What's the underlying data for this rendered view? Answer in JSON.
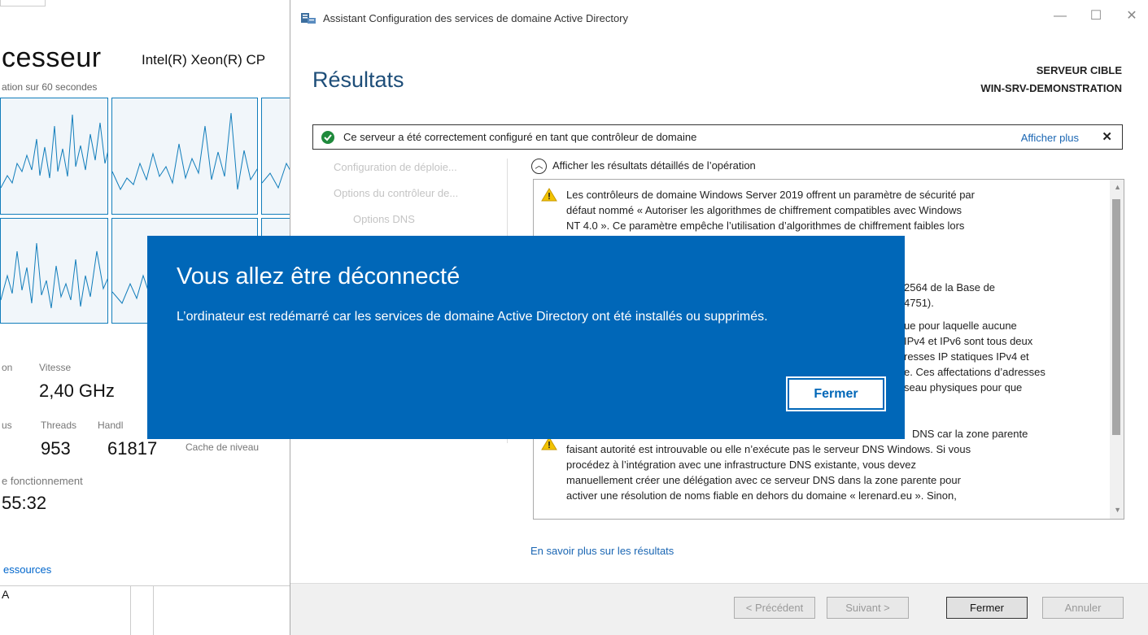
{
  "taskmanager": {
    "title": "cesseur",
    "cpu_name": "Intel(R) Xeon(R) CP",
    "subtitle": "ation sur 60 secondes",
    "stats": {
      "speed_label": "Vitesse",
      "speed_value": "2,40 GHz",
      "threads_label": "Threads",
      "threads_value": "953",
      "handles_label": "Handl",
      "handles_value": "61817",
      "cache_label": "Cache de niveau",
      "uptime_label": "e fonctionnement",
      "uptime_value": "55:32",
      "left_label_1": "on",
      "left_label_2": "us"
    },
    "resources_link": "essources",
    "bottom_letter": "A"
  },
  "wizard": {
    "title": "Assistant Configuration des services de domaine Active Directory",
    "heading": "Résultats",
    "target_label": "SERVEUR CIBLE",
    "target_name": "WIN-SRV-DEMONSTRATION",
    "success_text": "Ce serveur a été correctement configuré en tant que contrôleur de domaine",
    "show_more": "Afficher plus",
    "close_symbol": "✕",
    "nav": [
      "Configuration de déploie...",
      "Options du contrôleur de...",
      "Options DNS"
    ],
    "details_header": "Afficher les résultats détaillés de l’opération",
    "messages": [
      {
        "lines": [
          "Les contrôleurs de domaine Windows Server 2019 offrent un paramètre de sécurité par",
          "défaut nommé « Autoriser les algorithmes de chiffrement compatibles avec Windows",
          "NT 4.0 ». Ce paramètre empêche l’utilisation d’algorithmes de chiffrement faibles lors"
        ]
      },
      {
        "lines": [
          "2564 de la Base de",
          "4751)."
        ]
      },
      {
        "lines": [
          "ue pour laquelle aucune",
          "IPv4 et IPv6 sont tous deux",
          "resses IP statiques IPv4 et",
          "e. Ces affectations d’adresses",
          "seau physiques pour que"
        ]
      },
      {
        "lines": [
          "DNS car la zone parente",
          "faisant autorité est introuvable ou elle n’exécute pas le serveur DNS Windows. Si vous",
          "procédez à l’intégration avec une infrastructure DNS existante, vous devez",
          "manuellement créer une délégation avec ce serveur DNS dans la zone parente pour",
          "activer une résolution de noms fiable en dehors du domaine « lerenard.eu ». Sinon,"
        ]
      }
    ],
    "learn_more": "En savoir plus sur les résultats",
    "buttons": {
      "prev": "< Précédent",
      "next": "Suivant >",
      "close": "Fermer",
      "cancel": "Annuler"
    }
  },
  "toast": {
    "title": "Vous allez être déconnecté",
    "message": "L’ordinateur est redémarré car les services de domaine Active Directory ont été installés ou supprimés.",
    "button": "Fermer"
  },
  "colors": {
    "toast_bg": "#0067b8",
    "heading": "#1e4e79",
    "link": "#1a66b3",
    "success_green": "#1f8a3c",
    "warning_yellow": "#f2c300",
    "graph_line": "#117dbb"
  }
}
